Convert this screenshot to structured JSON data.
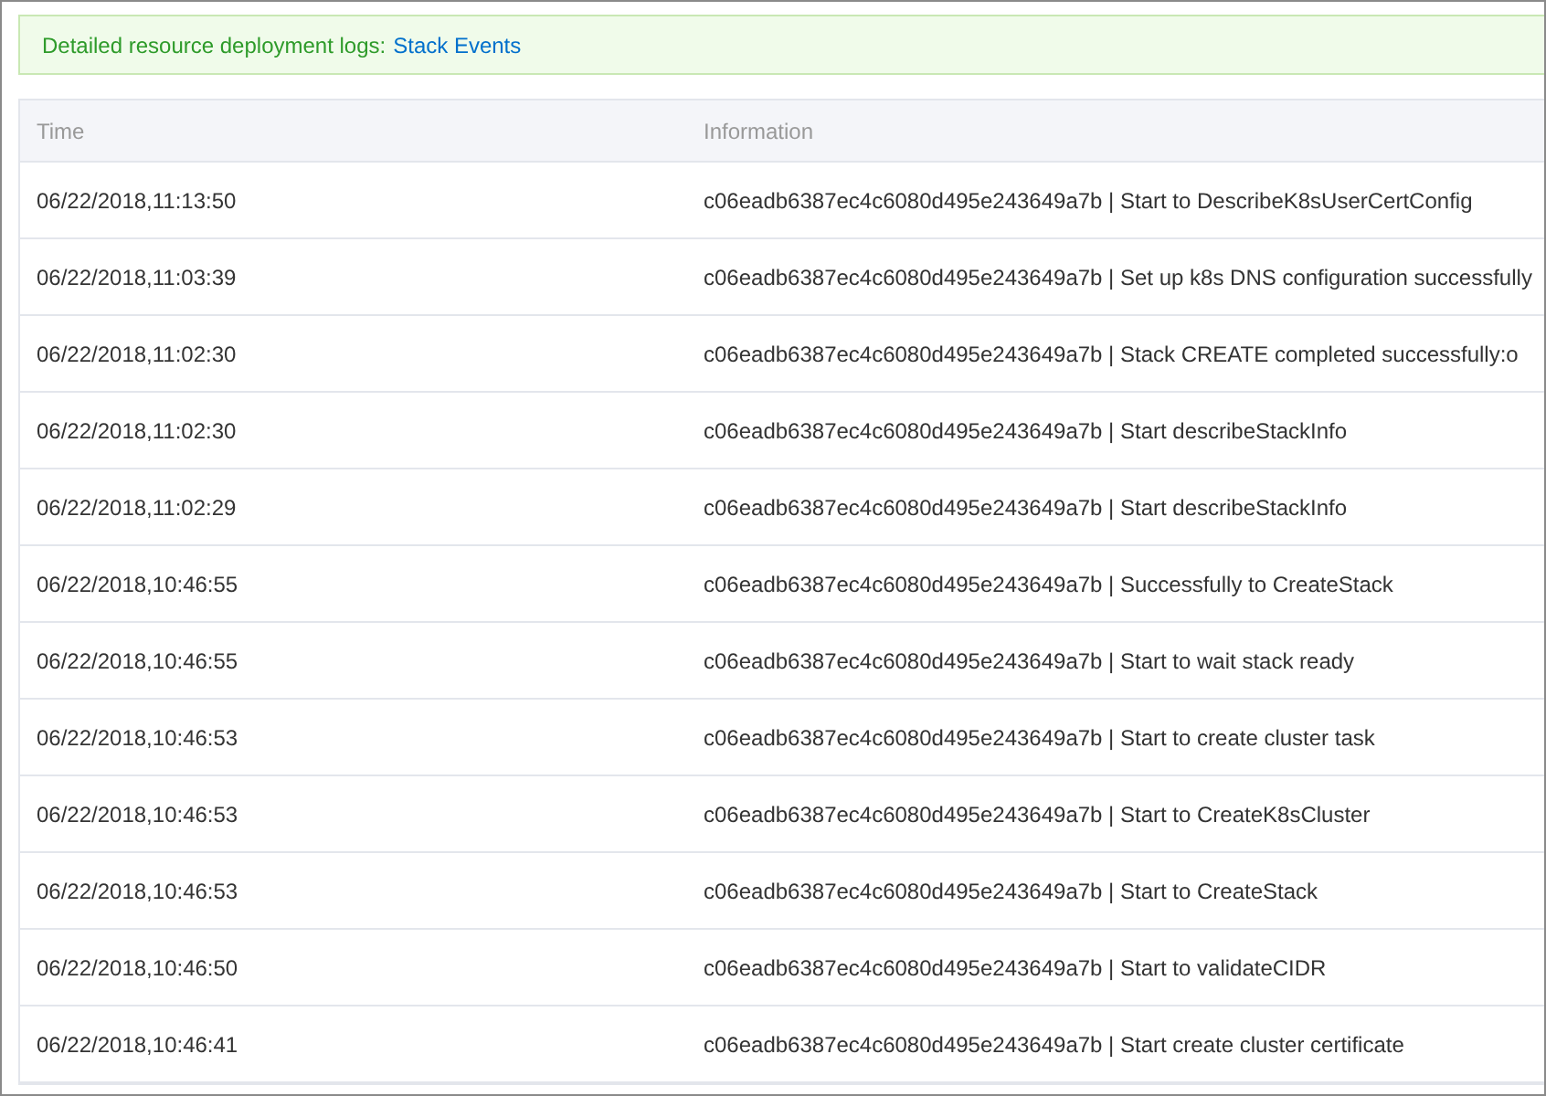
{
  "banner": {
    "text": "Detailed resource deployment logs:",
    "link": "Stack Events"
  },
  "table": {
    "columns": [
      "Time",
      "Information"
    ],
    "rows": [
      {
        "time": "06/22/2018,11:13:50",
        "information": "c06eadb6387ec4c6080d495e243649a7b | Start to DescribeK8sUserCertConfig"
      },
      {
        "time": "06/22/2018,11:03:39",
        "information": "c06eadb6387ec4c6080d495e243649a7b | Set up k8s DNS configuration successfully"
      },
      {
        "time": "06/22/2018,11:02:30",
        "information": "c06eadb6387ec4c6080d495e243649a7b | Stack CREATE completed successfully:o"
      },
      {
        "time": "06/22/2018,11:02:30",
        "information": "c06eadb6387ec4c6080d495e243649a7b | Start describeStackInfo"
      },
      {
        "time": "06/22/2018,11:02:29",
        "information": "c06eadb6387ec4c6080d495e243649a7b | Start describeStackInfo"
      },
      {
        "time": "06/22/2018,10:46:55",
        "information": "c06eadb6387ec4c6080d495e243649a7b | Successfully to CreateStack"
      },
      {
        "time": "06/22/2018,10:46:55",
        "information": "c06eadb6387ec4c6080d495e243649a7b | Start to wait stack ready"
      },
      {
        "time": "06/22/2018,10:46:53",
        "information": "c06eadb6387ec4c6080d495e243649a7b | Start to create cluster task"
      },
      {
        "time": "06/22/2018,10:46:53",
        "information": "c06eadb6387ec4c6080d495e243649a7b | Start to CreateK8sCluster"
      },
      {
        "time": "06/22/2018,10:46:53",
        "information": "c06eadb6387ec4c6080d495e243649a7b | Start to CreateStack"
      },
      {
        "time": "06/22/2018,10:46:50",
        "information": "c06eadb6387ec4c6080d495e243649a7b | Start to validateCIDR"
      },
      {
        "time": "06/22/2018,10:46:41",
        "information": "c06eadb6387ec4c6080d495e243649a7b | Start create cluster certificate"
      }
    ]
  }
}
